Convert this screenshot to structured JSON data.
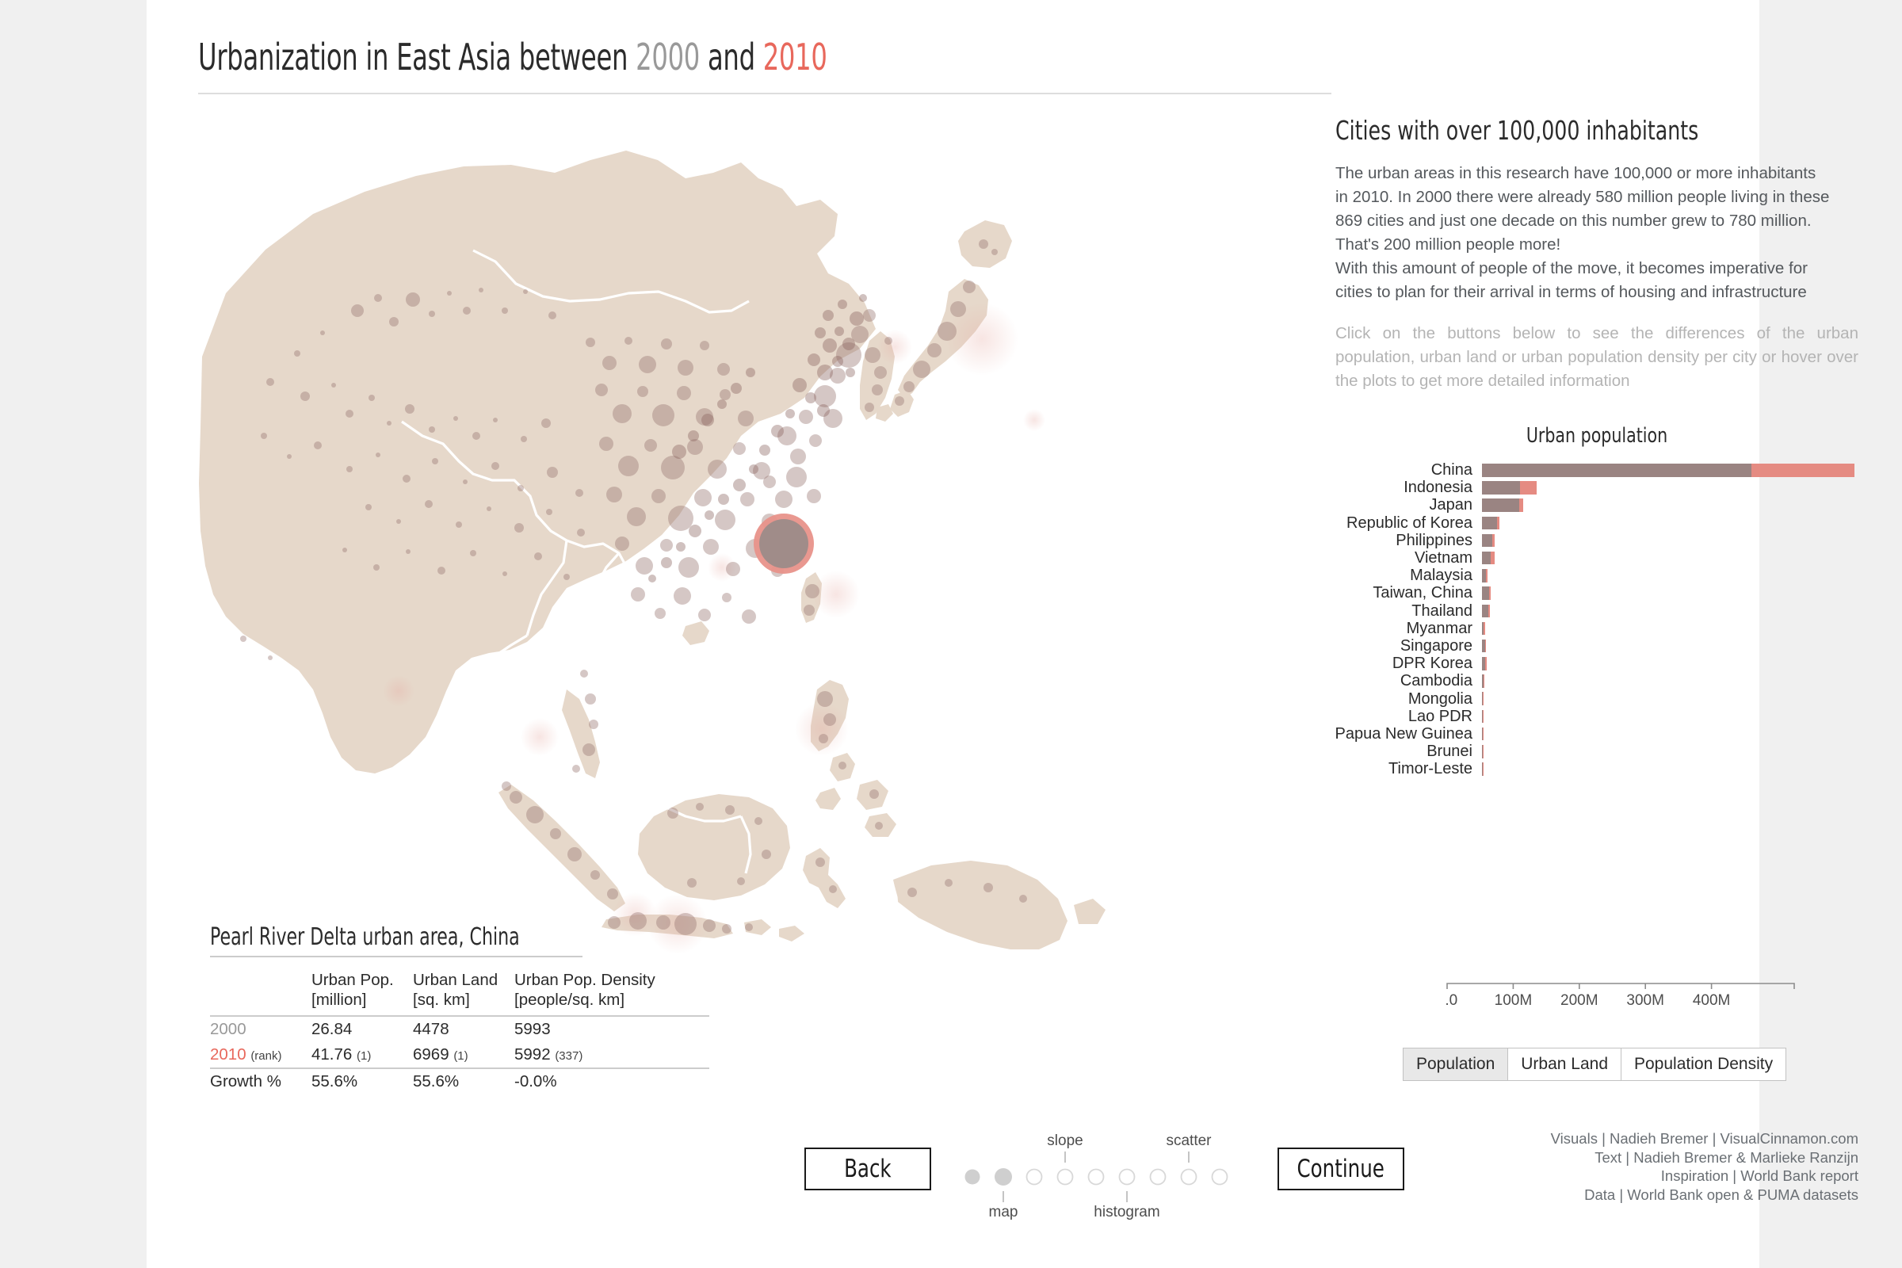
{
  "title": {
    "part1": "Urbanization in East Asia between ",
    "year_from": "2000",
    "part2": " and ",
    "year_to": "2010"
  },
  "panel": {
    "heading": "Cities with over 100,000 inhabitants",
    "body_line1": "The urban areas in this research have 100,000 or more inhabitants",
    "body_line2": "in 2010. In 2000 there were already 580 million people living in these",
    "body_line3": "869 cities and just one decade on this number grew to 780 million.",
    "body_line4": "That's 200 million people more!",
    "body_line5": "With this amount of people of the move, it becomes imperative for",
    "body_line6": "cities to plan for their arrival in terms of housing and infrastructure",
    "hint": "Click on the buttons below to see the differences of the urban population, urban land or urban population density per city or hover over the plots to get more detailed information"
  },
  "detail_table": {
    "title": "Pearl River Delta urban area, China",
    "columns": [
      {
        "line1": "Urban Pop.",
        "line2": "[million]"
      },
      {
        "line1": "Urban Land",
        "line2": "[sq. km]"
      },
      {
        "line1": "Urban Pop. Density",
        "line2": "[people/sq. km]"
      }
    ],
    "rows": [
      {
        "label": "2000",
        "label_suffix": "",
        "values": [
          "26.84",
          "4478",
          "5993"
        ],
        "ranks": [
          "",
          "",
          ""
        ]
      },
      {
        "label": "2010",
        "label_suffix": "(rank)",
        "values": [
          "41.76",
          "6969",
          "5992"
        ],
        "ranks": [
          "(1)",
          "(1)",
          "(337)"
        ]
      }
    ],
    "growth_label": "Growth %",
    "growth_values": [
      "55.6%",
      "55.6%",
      "-0.0%"
    ]
  },
  "chart_data": {
    "type": "bar",
    "title": "Urban population",
    "orientation": "horizontal",
    "stacked": true,
    "xlabel": "",
    "ylabel": "",
    "xlim": [
      0,
      480000000
    ],
    "grid": false,
    "legend": "none",
    "tick_labels": [
      "0.0",
      "100M",
      "200M",
      "300M",
      "400M"
    ],
    "tick_values": [
      0,
      100000000,
      200000000,
      300000000,
      400000000
    ],
    "categories": [
      "China",
      "Indonesia",
      "Japan",
      "Republic of Korea",
      "Philippines",
      "Vietnam",
      "Malaysia",
      "Taiwan, China",
      "Thailand",
      "Myanmar",
      "Singapore",
      "DPR Korea",
      "Cambodia",
      "Mongolia",
      "Lao PDR",
      "Papua New Guinea",
      "Brunei",
      "Timor-Leste"
    ],
    "series": [
      {
        "name": "2000",
        "color": "#9a8482",
        "values": [
          347000000,
          49000000,
          48000000,
          19000000,
          13000000,
          11000000,
          5500000,
          9500000,
          8000000,
          2500000,
          4000000,
          4500000,
          1600000,
          900000,
          500000,
          350000,
          170000,
          150000
        ]
      },
      {
        "name": "2010 growth",
        "color": "#e58b82",
        "values": [
          133000000,
          21000000,
          5000000,
          3500000,
          3500000,
          5500000,
          2000000,
          1500000,
          2000000,
          1600000,
          1200000,
          700000,
          900000,
          500000,
          350000,
          200000,
          90000,
          90000
        ]
      }
    ]
  },
  "toggle_buttons": [
    {
      "label": "Population",
      "active": true
    },
    {
      "label": "Urban Land",
      "active": false
    },
    {
      "label": "Population Density",
      "active": false
    }
  ],
  "nav": {
    "back": "Back",
    "continue": "Continue",
    "dots_total": 9,
    "dots_filled": 2,
    "current_index": 2,
    "labels_above": [
      {
        "label": "slope",
        "dot": 4
      },
      {
        "label": "scatter",
        "dot": 8
      }
    ],
    "labels_below": [
      {
        "label": "map",
        "dot": 2
      },
      {
        "label": "histogram",
        "dot": 6
      }
    ]
  },
  "credits": [
    "Visuals | Nadieh Bremer | VisualCinnamon.com",
    "Text | Nadieh Bremer & Marlieke Ranzijn",
    "Inspiration | World Bank report",
    "Data | World Bank open & PUMA datasets"
  ],
  "colors": {
    "land": "#e6d8ca",
    "border": "#ffffff",
    "bubble": "#9a7a74",
    "highlight_fill": "#9c8b89",
    "highlight_ring": "#e8928a",
    "accent_red": "#e8685c",
    "accent_gray": "#999999",
    "bar_past": "#9a8482",
    "bar_growth": "#e58b82",
    "page_bg": "#f0f0f0",
    "canvas_bg": "#ffffff"
  }
}
